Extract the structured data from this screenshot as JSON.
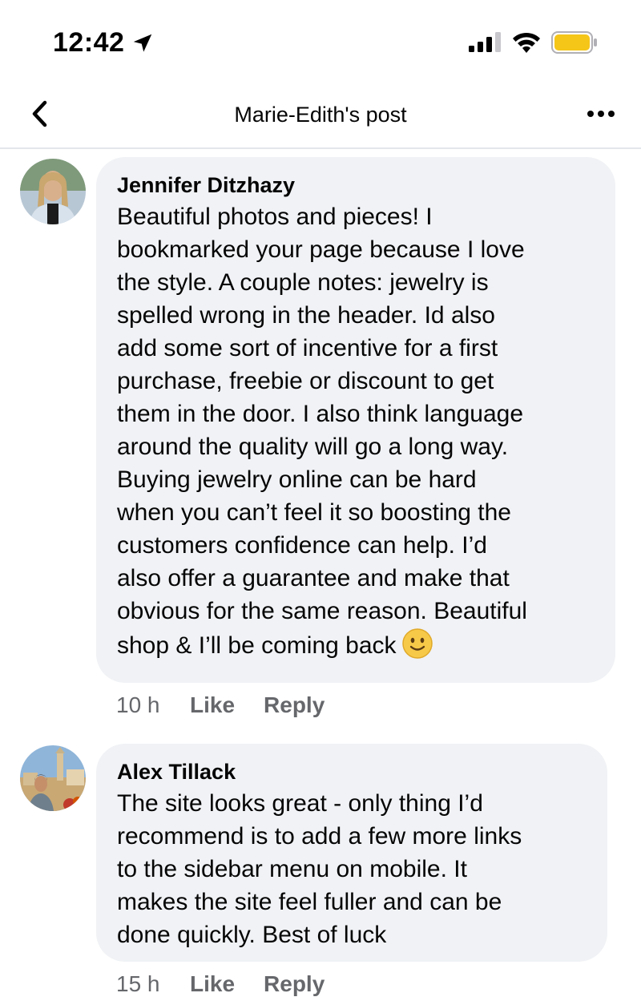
{
  "status_bar": {
    "time": "12:42",
    "icons": [
      "location-arrow-icon",
      "cellular-signal-icon",
      "wifi-icon",
      "battery-icon"
    ],
    "battery_color": "#f5c518"
  },
  "nav": {
    "title": "Marie-Edith's post",
    "back_icon": "chevron-left-icon",
    "more_icon": "more-horizontal-icon"
  },
  "comments": [
    {
      "author": "Jennifer Ditzhazy",
      "text": "Beautiful photos and pieces! I\nbookmarked your page because I love\nthe style. A couple notes: jewelry is\nspelled wrong in the header. Id also\nadd some sort of incentive for a first\npurchase, freebie or discount to get\nthem in the door. I also think language\naround the quality will go a long way.\nBuying jewelry online can be hard\nwhen you can’t feel it so boosting the\ncustomers confidence can help. I’d\nalso offer a guarantee and make that\nobvious for the same reason. Beautiful\nshop & I’ll be coming back",
      "emoji": "slightly-smiling-face-icon",
      "time": "10 h",
      "like_label": "Like",
      "reply_label": "Reply"
    },
    {
      "author": "Alex Tillack",
      "text": "The site looks great - only thing I’d\nrecommend is to add a few more links\nto the sidebar menu on mobile. It\nmakes the site feel fuller and can be\ndone quickly. Best of luck",
      "time": "15 h",
      "like_label": "Like",
      "reply_label": "Reply"
    }
  ],
  "colors": {
    "bubble_bg": "#f0f2f5",
    "secondary_text": "#65676b",
    "primary_text": "#050505"
  }
}
